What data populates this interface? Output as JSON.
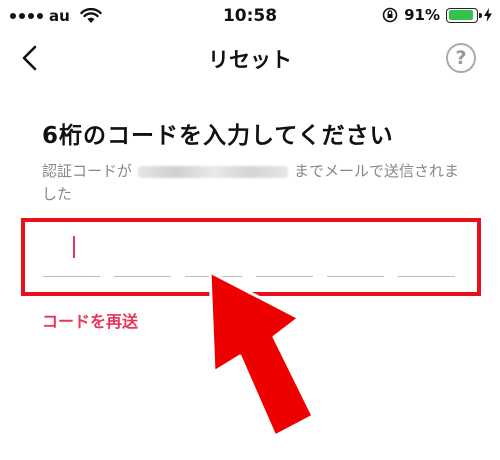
{
  "status": {
    "carrier": "au",
    "time": "10:58",
    "battery": "91%",
    "battery_level": 0.91
  },
  "nav": {
    "title": "リセット",
    "help_label": "?"
  },
  "main": {
    "heading": "6桁のコードを入力してください",
    "desc_before": "認証コードが",
    "desc_after": "までメールで送信されました",
    "resend_label": "コードを再送"
  },
  "colors": {
    "highlight": "#e8101c",
    "accent": "#e8355b",
    "arrow": "#ef0000"
  },
  "icons": [
    "back-chevron-icon",
    "help-icon",
    "wifi-icon",
    "orientation-lock-icon",
    "charging-bolt-icon"
  ]
}
